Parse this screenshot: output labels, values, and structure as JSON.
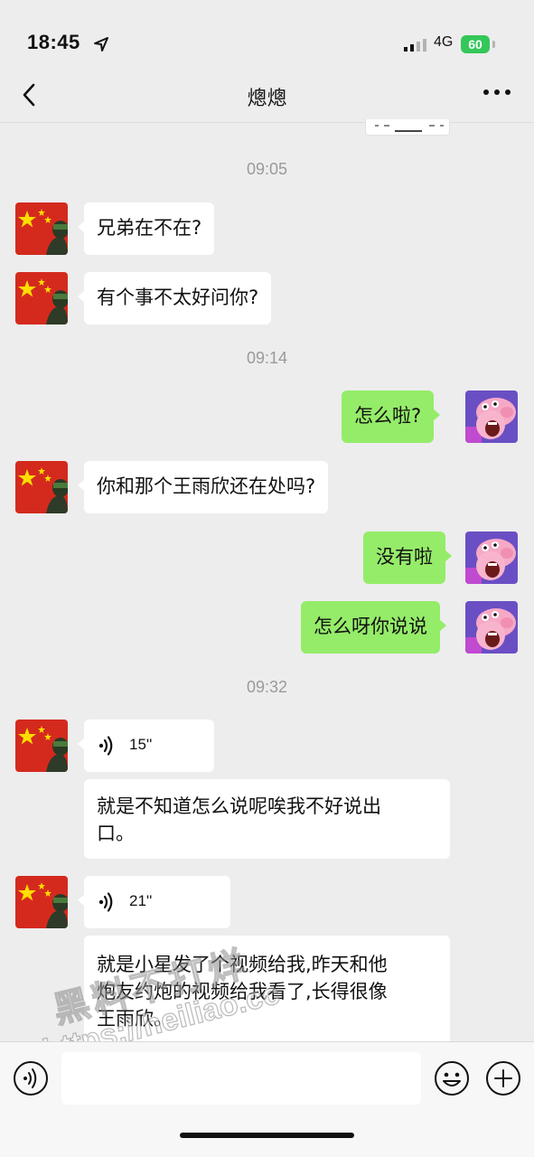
{
  "status_bar": {
    "time": "18:45",
    "network": "4G",
    "battery": "60"
  },
  "nav": {
    "title": "熜熜"
  },
  "messages": {
    "time_1": "09:05",
    "m1": "兄弟在不在?",
    "m2": "有个事不太好问你?",
    "time_2": "09:14",
    "m3": "怎么啦?",
    "m4": "你和那个王雨欣还在处吗?",
    "m5": "没有啦",
    "m6": "怎么呀你说说",
    "time_3": "09:32",
    "voice_1": "15''",
    "m7_line1": "就是不知道怎么说呢唉我不好说出",
    "m7_line2": "口。",
    "voice_2": "21''",
    "m8_line1": "就是小星发了个视频给我,昨天和他",
    "m8_line2": "炮友约炮的视频给我看了,长得很像",
    "m8_line3": "王雨欣。"
  },
  "watermark": {
    "line1": "黑料不打烊",
    "line2": "https://heiliao.cc"
  },
  "input_bar": {
    "placeholder": ""
  },
  "icons": {
    "back": "back-chevron-icon",
    "more": "more-dots-icon",
    "location": "location-arrow-icon",
    "signal": "signal-bars-icon",
    "voice": "voice-wave-icon",
    "emoji": "emoji-icon",
    "plus": "plus-icon"
  },
  "colors": {
    "background": "#ededed",
    "self_bubble": "#95ec69",
    "other_bubble": "#ffffff",
    "battery": "#34c759"
  }
}
